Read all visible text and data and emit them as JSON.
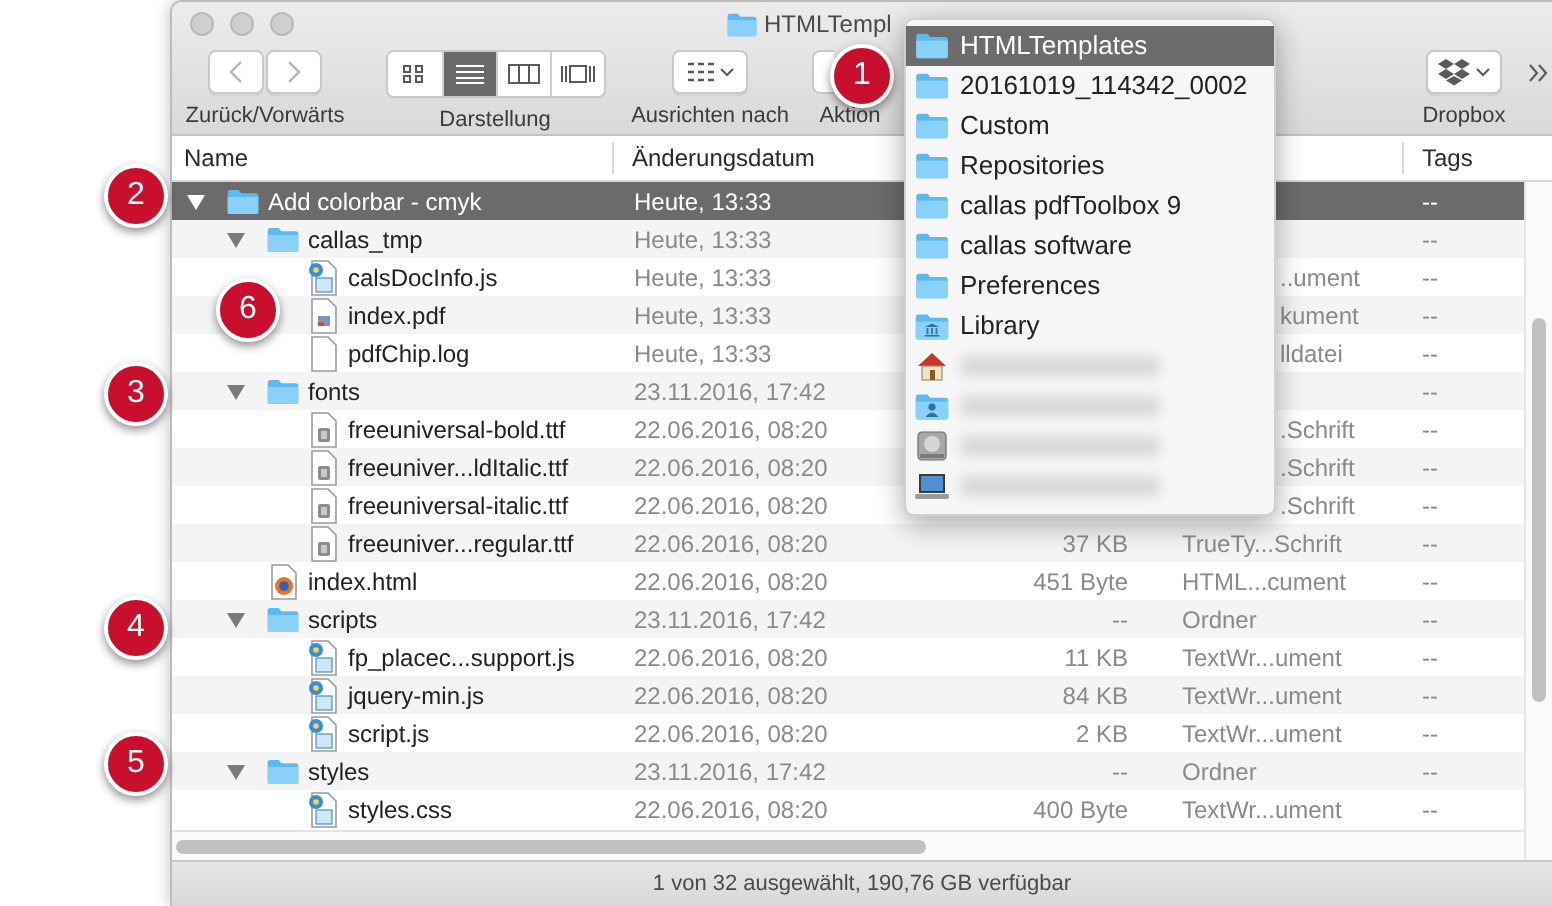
{
  "window": {
    "title": "HTMLTempl"
  },
  "toolbar": {
    "groups": [
      {
        "kind": "nav",
        "label": "Zurück/Vorwärts"
      },
      {
        "kind": "view",
        "label": "Darstellung",
        "views": [
          {
            "selected": false
          },
          {
            "selected": true
          },
          {
            "selected": false
          },
          {
            "selected": false
          }
        ]
      },
      {
        "kind": "arrange",
        "label": "Ausrichten nach"
      },
      {
        "kind": "action",
        "label": "Aktion"
      },
      {
        "kind": "dropbox",
        "label": "Dropbox"
      }
    ]
  },
  "columns": {
    "name": "Name",
    "date": "Änderungsdatum",
    "tags": "Tags"
  },
  "tree": [
    {
      "name": "Add colorbar - cmyk",
      "kind": "folder",
      "expanded": true,
      "selected": true,
      "date": "Heute, 13:33",
      "tags": "--",
      "children": [
        {
          "name": "callas_tmp",
          "kind": "folder",
          "expanded": true,
          "selected": false,
          "date": "Heute, 13:33",
          "tags": "--",
          "children": [
            {
              "name": "calsDocInfo.js",
              "kind": "script",
              "selected": false,
              "date": "Heute, 13:33",
              "file_type": "..ument",
              "file_type_cut": true,
              "tags": "--"
            },
            {
              "name": "index.pdf",
              "kind": "pdf",
              "selected": false,
              "date": "Heute, 13:33",
              "file_type": "kument",
              "file_type_cut": true,
              "tags": "--"
            },
            {
              "name": "pdfChip.log",
              "kind": "text",
              "selected": false,
              "date": "Heute, 13:33",
              "file_type": "lldatei",
              "file_type_cut": true,
              "tags": "--"
            }
          ]
        },
        {
          "name": "fonts",
          "kind": "folder",
          "expanded": true,
          "selected": false,
          "date": "23.11.2016, 17:42",
          "tags": "--",
          "children": [
            {
              "name": "freeuniversal-bold.ttf",
              "kind": "font",
              "selected": false,
              "date": "22.06.2016, 08:20",
              "file_type": ".Schrift",
              "file_type_cut": true,
              "tags": "--"
            },
            {
              "name": "freeuniver...ldItalic.ttf",
              "kind": "font",
              "selected": false,
              "date": "22.06.2016, 08:20",
              "file_type": ".Schrift",
              "file_type_cut": true,
              "tags": "--"
            },
            {
              "name": "freeuniversal-italic.ttf",
              "kind": "font",
              "selected": false,
              "date": "22.06.2016, 08:20",
              "file_type": ".Schrift",
              "file_type_cut": true,
              "tags": "--"
            },
            {
              "name": "freeuniver...regular.ttf",
              "kind": "font",
              "selected": false,
              "date": "22.06.2016, 08:20",
              "size": "37 KB",
              "file_type": "TrueTy...Schrift",
              "file_type_cut": false,
              "tags": "--"
            }
          ]
        },
        {
          "name": "index.html",
          "kind": "html",
          "selected": false,
          "date": "22.06.2016, 08:20",
          "size": "451 Byte",
          "file_type": "HTML...cument",
          "file_type_cut": false,
          "tags": "--"
        },
        {
          "name": "scripts",
          "kind": "folder",
          "expanded": true,
          "selected": false,
          "date": "23.11.2016, 17:42",
          "size": "--",
          "file_type": "Ordner",
          "file_type_cut": false,
          "tags": "--",
          "children": [
            {
              "name": "fp_placec...support.js",
              "kind": "script",
              "selected": false,
              "date": "22.06.2016, 08:20",
              "size": "11 KB",
              "file_type": "TextWr...ument",
              "file_type_cut": false,
              "tags": "--"
            },
            {
              "name": "jquery-min.js",
              "kind": "script",
              "selected": false,
              "date": "22.06.2016, 08:20",
              "size": "84 KB",
              "file_type": "TextWr...ument",
              "file_type_cut": false,
              "tags": "--"
            },
            {
              "name": "script.js",
              "kind": "script",
              "selected": false,
              "date": "22.06.2016, 08:20",
              "size": "2 KB",
              "file_type": "TextWr...ument",
              "file_type_cut": false,
              "tags": "--"
            }
          ]
        },
        {
          "name": "styles",
          "kind": "folder",
          "expanded": true,
          "selected": false,
          "date": "23.11.2016, 17:42",
          "size": "--",
          "file_type": "Ordner",
          "file_type_cut": false,
          "tags": "--",
          "children": [
            {
              "name": "styles.css",
              "kind": "script",
              "selected": false,
              "date": "22.06.2016, 08:20",
              "size": "400 Byte",
              "file_type": "TextWr...ument",
              "file_type_cut": false,
              "tags": "--"
            }
          ]
        }
      ]
    }
  ],
  "status_bar": "1 von 32 ausgewählt, 190,76 GB verfügbar",
  "path_menu": {
    "items": [
      {
        "kind": "folder",
        "label": "HTMLTemplates",
        "selected": true
      },
      {
        "kind": "folder",
        "label": "20161019_114342_0002",
        "selected": false
      },
      {
        "kind": "folder",
        "label": "Custom",
        "selected": false
      },
      {
        "kind": "folder",
        "label": "Repositories",
        "selected": false
      },
      {
        "kind": "folder",
        "label": "callas pdfToolbox 9",
        "selected": false
      },
      {
        "kind": "folder",
        "label": "callas software",
        "selected": false
      },
      {
        "kind": "folder",
        "label": "Preferences",
        "selected": false
      },
      {
        "kind": "library",
        "label": "Library",
        "selected": false
      },
      {
        "kind": "home",
        "selected": false
      },
      {
        "kind": "user",
        "selected": false
      },
      {
        "kind": "disk",
        "selected": false
      },
      {
        "kind": "laptop",
        "selected": false
      }
    ]
  },
  "callouts": [
    "1",
    "2",
    "3",
    "4",
    "5",
    "6"
  ]
}
